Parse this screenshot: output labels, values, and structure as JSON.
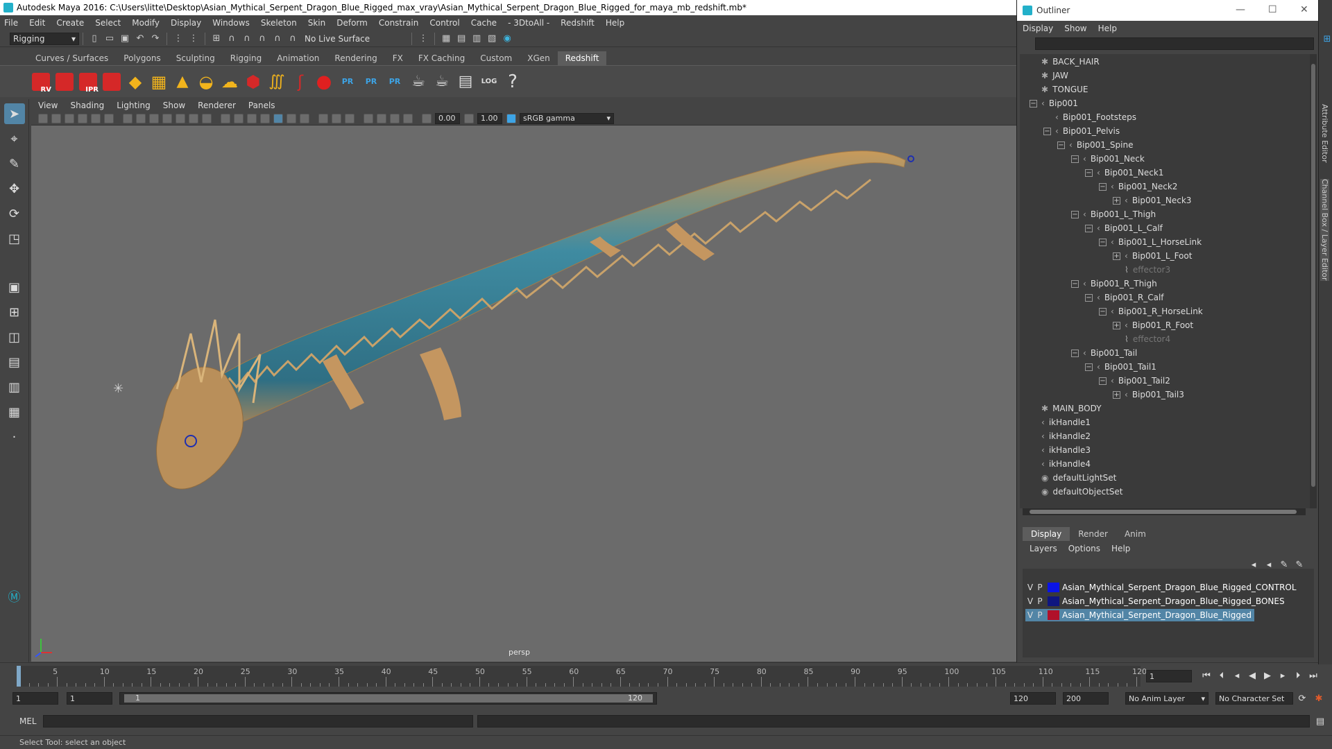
{
  "window": {
    "title": "Autodesk Maya 2016: C:\\Users\\litte\\Desktop\\Asian_Mythical_Serpent_Dragon_Blue_Rigged_max_vray\\Asian_Mythical_Serpent_Dragon_Blue_Rigged_for_maya_mb_redshift.mb*"
  },
  "menubar": [
    "File",
    "Edit",
    "Create",
    "Select",
    "Modify",
    "Display",
    "Windows",
    "Skeleton",
    "Skin",
    "Deform",
    "Constrain",
    "Control",
    "Cache",
    "- 3DtoAll -",
    "Redshift",
    "Help"
  ],
  "statusline": {
    "mode": "Rigging",
    "live_surface": "No Live Surface"
  },
  "shelf_tabs": [
    "Curves / Surfaces",
    "Polygons",
    "Sculpting",
    "Rigging",
    "Animation",
    "Rendering",
    "FX",
    "FX Caching",
    "Custom",
    "XGen",
    "Redshift"
  ],
  "shelf_active": "Redshift",
  "shelf_labels": {
    "rv": "RV",
    "ipr": "IPR",
    "pr": "PR",
    "log": "LOG",
    "help": "?"
  },
  "viewport": {
    "menu": [
      "View",
      "Shading",
      "Lighting",
      "Show",
      "Renderer",
      "Panels"
    ],
    "exposure": "0.00",
    "gamma": "1.00",
    "colorspace": "sRGB gamma",
    "camera": "persp"
  },
  "timeline": {
    "ticks": [
      "5",
      "10",
      "15",
      "20",
      "25",
      "30",
      "35",
      "40",
      "45",
      "50",
      "55",
      "60",
      "65",
      "70",
      "75",
      "80",
      "85",
      "90",
      "95",
      "100",
      "105",
      "110",
      "115",
      "120"
    ],
    "start_tick": "1",
    "current_frame": "1"
  },
  "range": {
    "start": "1",
    "playback_start": "1",
    "slider_start": "1",
    "slider_end": "120",
    "playback_end": "120",
    "end": "200",
    "anim_layer": "No Anim Layer",
    "char_set": "No Character Set"
  },
  "cmdline": {
    "label": "MEL"
  },
  "helpline": {
    "text": "Select Tool: select an object"
  },
  "outliner": {
    "title": "Outliner",
    "menu": [
      "Display",
      "Show",
      "Help"
    ],
    "rows": [
      {
        "label": "BACK_HAIR",
        "indent": 0,
        "exp": "",
        "icon": "✱",
        "dim": false
      },
      {
        "label": "JAW",
        "indent": 0,
        "exp": "",
        "icon": "✱",
        "dim": false
      },
      {
        "label": "TONGUE",
        "indent": 0,
        "exp": "",
        "icon": "✱",
        "dim": false
      },
      {
        "label": "Bip001",
        "indent": 0,
        "exp": "−",
        "icon": "‹",
        "dim": false
      },
      {
        "label": "Bip001_Footsteps",
        "indent": 1,
        "exp": "",
        "icon": "‹",
        "dim": false
      },
      {
        "label": "Bip001_Pelvis",
        "indent": 1,
        "exp": "−",
        "icon": "‹",
        "dim": false
      },
      {
        "label": "Bip001_Spine",
        "indent": 2,
        "exp": "−",
        "icon": "‹",
        "dim": false
      },
      {
        "label": "Bip001_Neck",
        "indent": 3,
        "exp": "−",
        "icon": "‹",
        "dim": false
      },
      {
        "label": "Bip001_Neck1",
        "indent": 4,
        "exp": "−",
        "icon": "‹",
        "dim": false
      },
      {
        "label": "Bip001_Neck2",
        "indent": 5,
        "exp": "−",
        "icon": "‹",
        "dim": false
      },
      {
        "label": "Bip001_Neck3",
        "indent": 6,
        "exp": "+",
        "icon": "‹",
        "dim": false
      },
      {
        "label": "Bip001_L_Thigh",
        "indent": 3,
        "exp": "−",
        "icon": "‹",
        "dim": false
      },
      {
        "label": "Bip001_L_Calf",
        "indent": 4,
        "exp": "−",
        "icon": "‹",
        "dim": false
      },
      {
        "label": "Bip001_L_HorseLink",
        "indent": 5,
        "exp": "−",
        "icon": "‹",
        "dim": false
      },
      {
        "label": "Bip001_L_Foot",
        "indent": 6,
        "exp": "+",
        "icon": "‹",
        "dim": false
      },
      {
        "label": "effector3",
        "indent": 6,
        "exp": "",
        "icon": "⌇",
        "dim": true
      },
      {
        "label": "Bip001_R_Thigh",
        "indent": 3,
        "exp": "−",
        "icon": "‹",
        "dim": false
      },
      {
        "label": "Bip001_R_Calf",
        "indent": 4,
        "exp": "−",
        "icon": "‹",
        "dim": false
      },
      {
        "label": "Bip001_R_HorseLink",
        "indent": 5,
        "exp": "−",
        "icon": "‹",
        "dim": false
      },
      {
        "label": "Bip001_R_Foot",
        "indent": 6,
        "exp": "+",
        "icon": "‹",
        "dim": false
      },
      {
        "label": "effector4",
        "indent": 6,
        "exp": "",
        "icon": "⌇",
        "dim": true
      },
      {
        "label": "Bip001_Tail",
        "indent": 3,
        "exp": "−",
        "icon": "‹",
        "dim": false
      },
      {
        "label": "Bip001_Tail1",
        "indent": 4,
        "exp": "−",
        "icon": "‹",
        "dim": false
      },
      {
        "label": "Bip001_Tail2",
        "indent": 5,
        "exp": "−",
        "icon": "‹",
        "dim": false
      },
      {
        "label": "Bip001_Tail3",
        "indent": 6,
        "exp": "+",
        "icon": "‹",
        "dim": false
      },
      {
        "label": "MAIN_BODY",
        "indent": 0,
        "exp": "",
        "icon": "✱",
        "dim": false
      },
      {
        "label": "ikHandle1",
        "indent": 0,
        "exp": "",
        "icon": "‹",
        "dim": false
      },
      {
        "label": "ikHandle2",
        "indent": 0,
        "exp": "",
        "icon": "‹",
        "dim": false
      },
      {
        "label": "ikHandle3",
        "indent": 0,
        "exp": "",
        "icon": "‹",
        "dim": false
      },
      {
        "label": "ikHandle4",
        "indent": 0,
        "exp": "",
        "icon": "‹",
        "dim": false
      },
      {
        "label": "defaultLightSet",
        "indent": 0,
        "exp": "",
        "icon": "◉",
        "dim": false
      },
      {
        "label": "defaultObjectSet",
        "indent": 0,
        "exp": "",
        "icon": "◉",
        "dim": false
      }
    ]
  },
  "layer_editor": {
    "tabs": [
      "Display",
      "Render",
      "Anim"
    ],
    "active_tab": "Display",
    "menu": [
      "Layers",
      "Options",
      "Help"
    ],
    "layers": [
      {
        "v": "V",
        "p": "P",
        "color": "#0a14e6",
        "name": "Asian_Mythical_Serpent_Dragon_Blue_Rigged_CONTROL",
        "selected": false
      },
      {
        "v": "V",
        "p": "P",
        "color": "#0f1680",
        "name": "Asian_Mythical_Serpent_Dragon_Blue_Rigged_BONES",
        "selected": false
      },
      {
        "v": "V",
        "p": "P",
        "color": "#b0102a",
        "name": "Asian_Mythical_Serpent_Dragon_Blue_Rigged",
        "selected": true
      }
    ]
  },
  "side_tabs": [
    "Attribute Editor",
    "Channel Box / Layer Editor"
  ],
  "colors": {
    "accent": "#5285a6",
    "redshift_red": "#d52828"
  }
}
